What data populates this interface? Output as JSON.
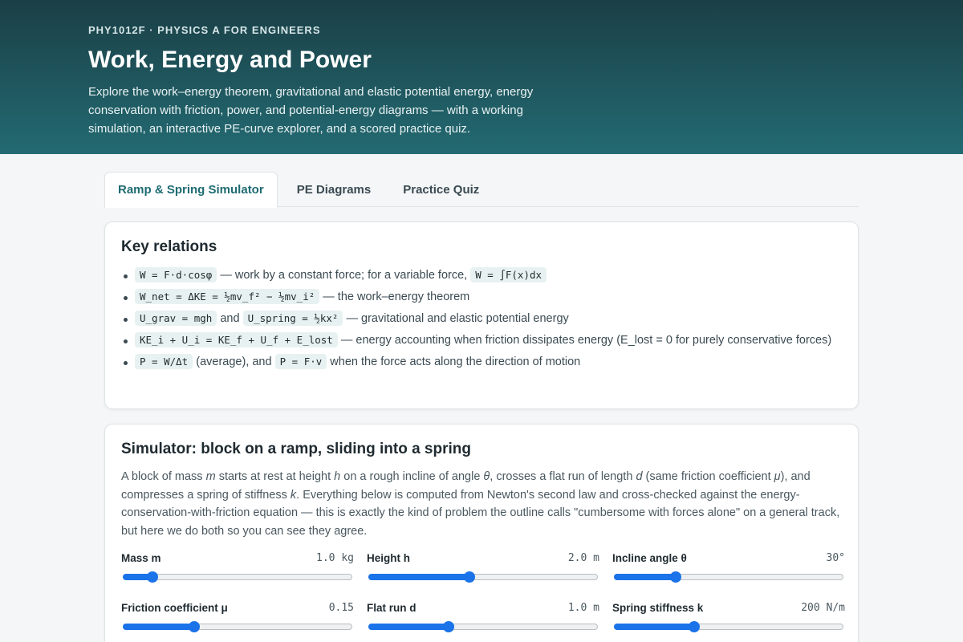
{
  "header": {
    "course": "PHY1012F · PHYSICS A FOR ENGINEERS",
    "title": "Work, Energy and Power",
    "intro": "Explore the work–energy theorem, gravitational and elastic potential energy, energy conservation with friction, power, and potential-energy diagrams — with a working simulation, an interactive PE-curve explorer, and a scored practice quiz."
  },
  "tabs": [
    {
      "label": "Ramp & Spring Simulator",
      "active": true
    },
    {
      "label": "PE Diagrams",
      "active": false
    },
    {
      "label": "Practice Quiz",
      "active": false
    }
  ],
  "key_relations": {
    "title": "Key relations",
    "items": [
      {
        "c1": "W = F·d·cosφ",
        "t1": " — work by a constant force; for a variable force, ",
        "c2": "W = ∫F(x)dx",
        "t2": ""
      },
      {
        "c1": "W_net = ΔKE = ½mv_f² − ½mv_i²",
        "t1": " — the work–energy theorem",
        "c2": "",
        "t2": ""
      },
      {
        "c1": "U_grav = mgh",
        "t1": " and ",
        "c2": "U_spring = ½kx²",
        "t2": " — gravitational and elastic potential energy"
      },
      {
        "c1": "KE_i + U_i = KE_f + U_f + E_lost",
        "t1": " — energy accounting when friction dissipates energy (E_lost = 0 for purely conservative forces)",
        "c2": "",
        "t2": ""
      },
      {
        "c1": "P = W/Δt",
        "t1": " (average), and ",
        "c2": "P = F·v",
        "t2": " when the force acts along the direction of motion"
      }
    ]
  },
  "simulator": {
    "title": "Simulator: block on a ramp, sliding into a spring",
    "desc": {
      "p1": "A block of mass ",
      "v1": "m",
      "p2": " starts at rest at height ",
      "v2": "h",
      "p3": " on a rough incline of angle ",
      "v3": "θ",
      "p4": ", crosses a flat run of length ",
      "v4": "d",
      "p5": " (same friction coefficient ",
      "v5": "μ",
      "p6": "), and compresses a spring of stiffness ",
      "v6": "k",
      "p7": ". Everything below is computed from Newton's second law and cross-checked against the energy-conservation-with-friction equation — this is exactly the kind of problem the outline calls \"cumbersome with forces alone\" on a general track, but here we do both so you can see they agree."
    },
    "controls": [
      {
        "label": "Mass m",
        "value": "1.0 kg",
        "level": 0.13
      },
      {
        "label": "Height h",
        "value": "2.0 m",
        "level": 0.44
      },
      {
        "label": "Incline angle θ",
        "value": "30°",
        "level": 0.27
      },
      {
        "label": "Friction coefficient μ",
        "value": "0.15",
        "level": 0.31
      },
      {
        "label": "Flat run d",
        "value": "1.0 m",
        "level": 0.35
      },
      {
        "label": "Spring stiffness k",
        "value": "200 N/m",
        "level": 0.35
      }
    ]
  },
  "colors": {
    "accent": "#1a73e8",
    "header_top": "#1b3f46",
    "header_bottom": "#236a72",
    "tab_active_text": "#1e6b72"
  }
}
